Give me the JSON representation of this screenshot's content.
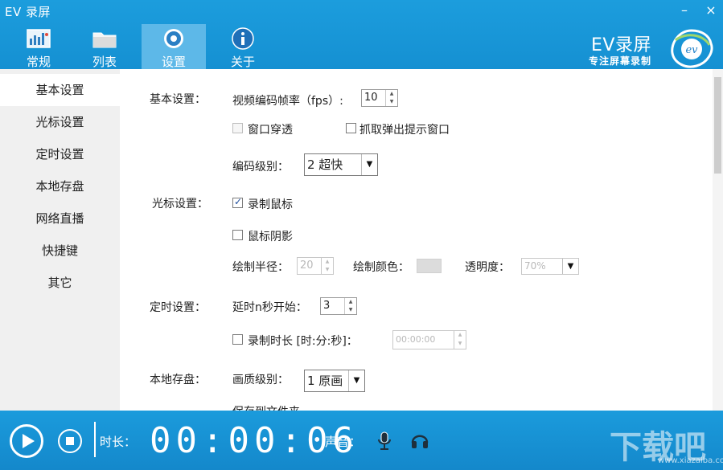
{
  "app": {
    "title": "EV 录屏"
  },
  "window": {
    "minimize": "–",
    "close": "×"
  },
  "nav": {
    "tabs": [
      {
        "label": "常规",
        "icon": "dashboard-icon"
      },
      {
        "label": "列表",
        "icon": "folder-icon"
      },
      {
        "label": "设置",
        "icon": "settings-icon",
        "active": true
      },
      {
        "label": "关于",
        "icon": "info-icon"
      }
    ]
  },
  "brand": {
    "name": "EV录屏",
    "tagline": "专注屏幕录制",
    "logo_text": "ev"
  },
  "sidebar": {
    "items": [
      {
        "label": "基本设置",
        "active": true
      },
      {
        "label": "光标设置"
      },
      {
        "label": "定时设置"
      },
      {
        "label": "本地存盘"
      },
      {
        "label": "网络直播"
      },
      {
        "label": "快捷键"
      },
      {
        "label": "其它"
      }
    ]
  },
  "basic": {
    "section": "基本设置：",
    "fps_label": "视频编码帧率（fps）:",
    "fps_value": "10",
    "window_through": "窗口穿透",
    "capture_popup": "抓取弹出提示窗口",
    "encode_level_label": "编码级别：",
    "encode_level_value": "2 超快"
  },
  "cursor": {
    "section": "光标设置：",
    "record_mouse": "录制鼠标",
    "mouse_shadow": "鼠标阴影",
    "radius_label": "绘制半径：",
    "radius_value": "20",
    "color_label": "绘制颜色：",
    "opacity_label": "透明度：",
    "opacity_value": "70%"
  },
  "timer": {
    "section": "定时设置：",
    "delay_label": "延时n秒开始：",
    "delay_value": "3",
    "duration_label": "录制时长 [时:分:秒]：",
    "duration_value": "00:00:00"
  },
  "storage": {
    "section": "本地存盘：",
    "quality_label": "画质级别：",
    "quality_value": "1 原画",
    "save_to_label": "保存到文件夹"
  },
  "bottom": {
    "duration_label": "时长：",
    "time": "00:00:06",
    "sound_label": "声音："
  },
  "watermark": {
    "text": "下载吧",
    "url_text": "www.xiazaiba.com"
  }
}
